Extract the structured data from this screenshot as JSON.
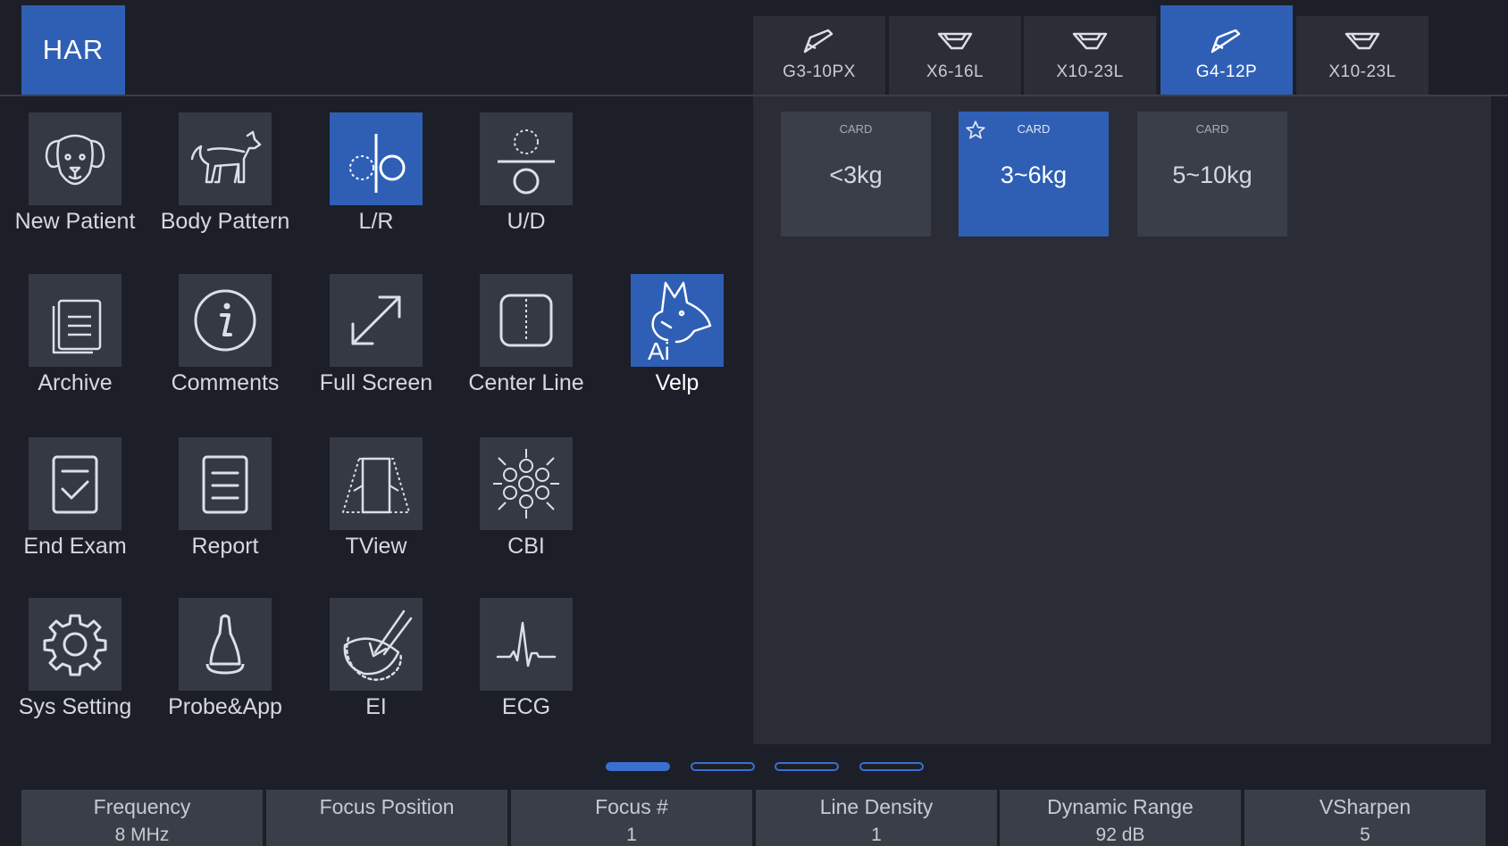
{
  "header": {
    "mode_tab": "HAR",
    "probes": [
      {
        "label": "G3-10PX",
        "icon": "convex-probe-icon"
      },
      {
        "label": "X6-16L",
        "icon": "linear-probe-icon"
      },
      {
        "label": "X10-23L",
        "icon": "linear-probe-icon"
      },
      {
        "label": "G4-12P",
        "icon": "convex-probe-icon",
        "active": true
      },
      {
        "label": "X10-23L",
        "icon": "linear-probe-icon"
      }
    ]
  },
  "presets": [
    {
      "tag": "CARD",
      "value": "<3kg"
    },
    {
      "tag": "CARD",
      "value": "3~6kg",
      "active": true,
      "starred": true
    },
    {
      "tag": "CARD",
      "value": "5~10kg"
    }
  ],
  "functions": [
    {
      "label": "New Patient",
      "icon": "dog-face-icon"
    },
    {
      "label": "Body Pattern",
      "icon": "dog-body-icon"
    },
    {
      "label": "L/R",
      "icon": "left-right-icon",
      "active": true
    },
    {
      "label": "U/D",
      "icon": "up-down-icon"
    },
    {
      "label": "Archive",
      "icon": "archive-icon"
    },
    {
      "label": "Comments",
      "icon": "info-icon"
    },
    {
      "label": "Full Screen",
      "icon": "expand-icon"
    },
    {
      "label": "Center Line",
      "icon": "center-line-icon"
    },
    {
      "label": "Velp",
      "icon": "ai-pet-icon",
      "active": true
    },
    {
      "label": "End Exam",
      "icon": "end-exam-icon"
    },
    {
      "label": "Report",
      "icon": "report-icon"
    },
    {
      "label": "TView",
      "icon": "tview-icon"
    },
    {
      "label": "CBI",
      "icon": "cbi-icon"
    },
    {
      "label": "Sys Setting",
      "icon": "gear-icon"
    },
    {
      "label": "Probe&App",
      "icon": "probe-icon"
    },
    {
      "label": "EI",
      "icon": "ei-icon"
    },
    {
      "label": "ECG",
      "icon": "ecg-icon"
    }
  ],
  "pagination": {
    "pages": 4,
    "current": 1
  },
  "params": [
    {
      "name": "Frequency",
      "value": "8 MHz"
    },
    {
      "name": "Focus Position",
      "value": ""
    },
    {
      "name": "Focus #",
      "value": "1"
    },
    {
      "name": "Line Density",
      "value": "1"
    },
    {
      "name": "Dynamic Range",
      "value": "92 dB"
    },
    {
      "name": "VSharpen",
      "value": "5"
    }
  ],
  "colors": {
    "accent": "#2f5fb5",
    "background": "#1c1f28",
    "panel": "#2a2d36",
    "tile": "#353943"
  }
}
